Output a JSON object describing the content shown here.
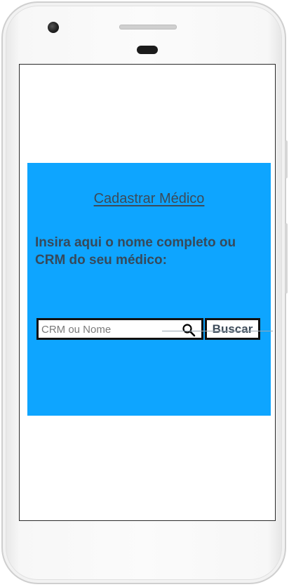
{
  "card": {
    "title": "Cadastrar Médico",
    "instruction": "Insira aqui o nome completo ou CRM do seu médico:"
  },
  "search": {
    "placeholder": "CRM ou Nome",
    "button_label": "Buscar"
  },
  "colors": {
    "card_background": "#0ea5ff",
    "text": "#37495a"
  },
  "icons": {
    "search": "search-icon"
  }
}
